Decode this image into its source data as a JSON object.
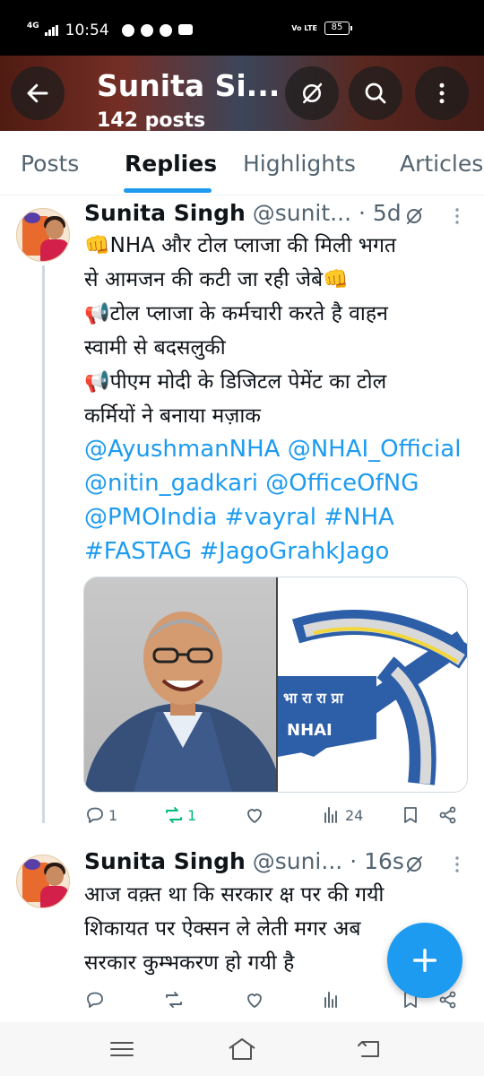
{
  "status_bar": {
    "network": "4G",
    "time": "10:54",
    "volte": "Vo LTE",
    "battery": "85",
    "app_icons": [
      "whatsapp-icon",
      "snapchat-icon",
      "messenger-icon",
      "youtube-icon"
    ]
  },
  "profile_header": {
    "name": "Sunita Si...",
    "posts_count": "142 posts",
    "buttons": [
      "back-arrow-icon",
      "grok-icon",
      "search-icon",
      "more-vertical-icon"
    ]
  },
  "tabs": [
    {
      "label": "Posts",
      "active": false
    },
    {
      "label": "Replies",
      "active": true
    },
    {
      "label": "Highlights",
      "active": false
    },
    {
      "label": "Articles",
      "active": false
    }
  ],
  "tweets": [
    {
      "name": "Sunita Singh",
      "handle": "@sunit...",
      "time": "· 5d",
      "body_lines": [
        "👊NHA और टोल प्लाजा की मिली भगत",
        "से आमजन की कटी जा रही जेबे👊",
        "📢टोल प्लाजा के कर्मचारी करते है वाहन",
        "स्वामी से बदसलुकी",
        "📢पीएम मोदी के डिजिटल पेमेंट का टोल",
        "कर्मियों ने बनाया मज़ाक"
      ],
      "tag_lines": [
        "@AyushmanNHA @NHAI_Official",
        "@nitin_gadkari @OfficeOfNG",
        "@PMOIndia #vayral #NHA",
        "#FASTAG #JagoGrahkJago"
      ],
      "media": {
        "right_logo_text_top": "भा रा रा प्रा",
        "right_logo_text_bottom": "NHAI"
      },
      "actions": {
        "replies": "1",
        "reposts": "1",
        "likes": "",
        "views": "24"
      }
    },
    {
      "name": "Sunita Singh",
      "handle": "@suni...",
      "time": "· 16s",
      "body_lines": [
        "आज वक़्त था कि सरकार क्ष पर की गयी",
        "शिकायत पर ऐक्सन ले लेती मगर अब",
        "सरकार कुम्भकरण हो गयी है"
      ],
      "actions": {
        "replies": "",
        "reposts": "",
        "likes": "",
        "views": ""
      }
    }
  ],
  "colors": {
    "accent": "#1d9bf0",
    "repost_active": "#00ba7c",
    "secondary_text": "#536471"
  }
}
